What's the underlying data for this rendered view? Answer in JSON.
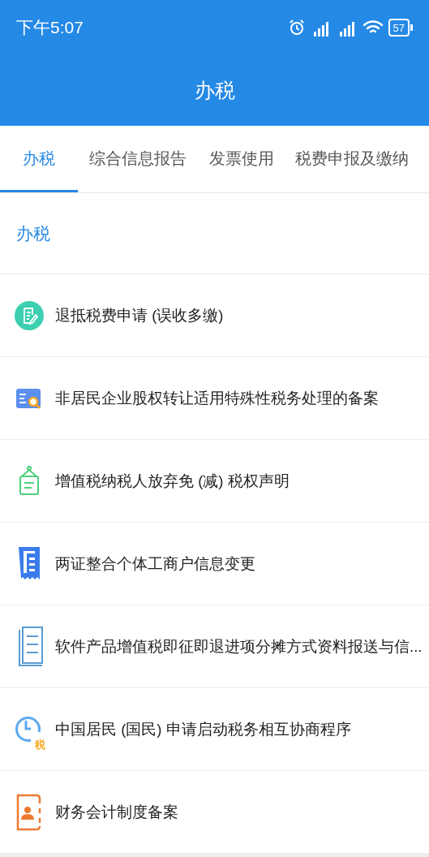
{
  "status_bar": {
    "time": "下午5:07",
    "battery": "57"
  },
  "title": "办税",
  "tabs": [
    {
      "label": "办税",
      "selected": true
    },
    {
      "label": "综合信息报告",
      "selected": false
    },
    {
      "label": "发票使用",
      "selected": false
    },
    {
      "label": "税费申报及缴纳",
      "selected": false
    }
  ],
  "section": {
    "title": "办税"
  },
  "items": [
    {
      "kind": "form",
      "label": "退抵税费申请 (误收多缴)"
    },
    {
      "kind": "search",
      "label": "非居民企业股权转让适用特殊性税务处理的备案"
    },
    {
      "kind": "sign",
      "label": "增值税纳税人放弃免 (减) 税权声明"
    },
    {
      "kind": "receipt",
      "label": "两证整合个体工商户信息变更"
    },
    {
      "kind": "document",
      "label": "软件产品增值税即征即退进项分摊方式资料报送与信..."
    },
    {
      "kind": "clock",
      "label": "中国居民 (国民) 申请启动税务相互协商程序",
      "icon_label": "税"
    },
    {
      "kind": "contact",
      "label": "财务会计制度备案"
    }
  ]
}
